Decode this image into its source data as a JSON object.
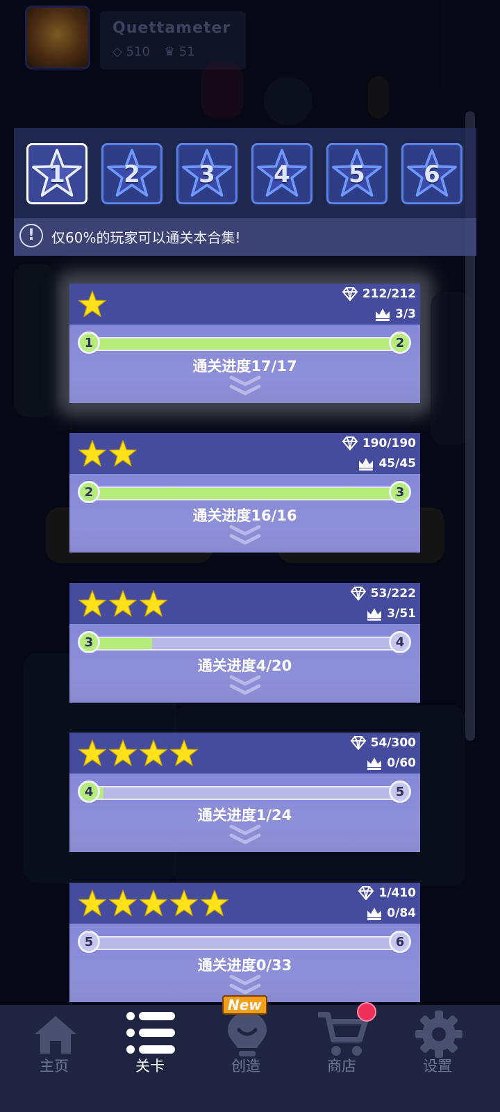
{
  "profile": {
    "name": "Quettameter",
    "gems": "510",
    "crowns": "51"
  },
  "collections": {
    "tabs": [
      "1",
      "2",
      "3",
      "4",
      "5",
      "6"
    ],
    "active_tab": "1",
    "notice": "仅60%的玩家可以通关本合集!"
  },
  "levels": [
    {
      "stars": 1,
      "gems": "212/212",
      "crowns": "3/3",
      "from": "1",
      "to": "2",
      "progress_label": "通关进度17/17",
      "progress": 1.0
    },
    {
      "stars": 2,
      "gems": "190/190",
      "crowns": "45/45",
      "from": "2",
      "to": "3",
      "progress_label": "通关进度16/16",
      "progress": 1.0
    },
    {
      "stars": 3,
      "gems": "53/222",
      "crowns": "3/51",
      "from": "3",
      "to": "4",
      "progress_label": "通关进度4/20",
      "progress": 0.2
    },
    {
      "stars": 4,
      "gems": "54/300",
      "crowns": "0/60",
      "from": "4",
      "to": "5",
      "progress_label": "通关进度1/24",
      "progress": 0.042
    },
    {
      "stars": 5,
      "gems": "1/410",
      "crowns": "0/84",
      "from": "5",
      "to": "6",
      "progress_label": "通关进度0/33",
      "progress": 0.0
    }
  ],
  "nav": {
    "home": "主页",
    "levels": "关卡",
    "create": "创造",
    "shop": "商店",
    "settings": "设置",
    "new_badge": "New"
  },
  "colors": {
    "progress_fill": "#b6ec7c",
    "star": "#ffe21a",
    "card_header": "#454c9e",
    "card_body": "#8a8ad6",
    "tab_border": "#5a84e8",
    "notification": "#f0305a"
  }
}
